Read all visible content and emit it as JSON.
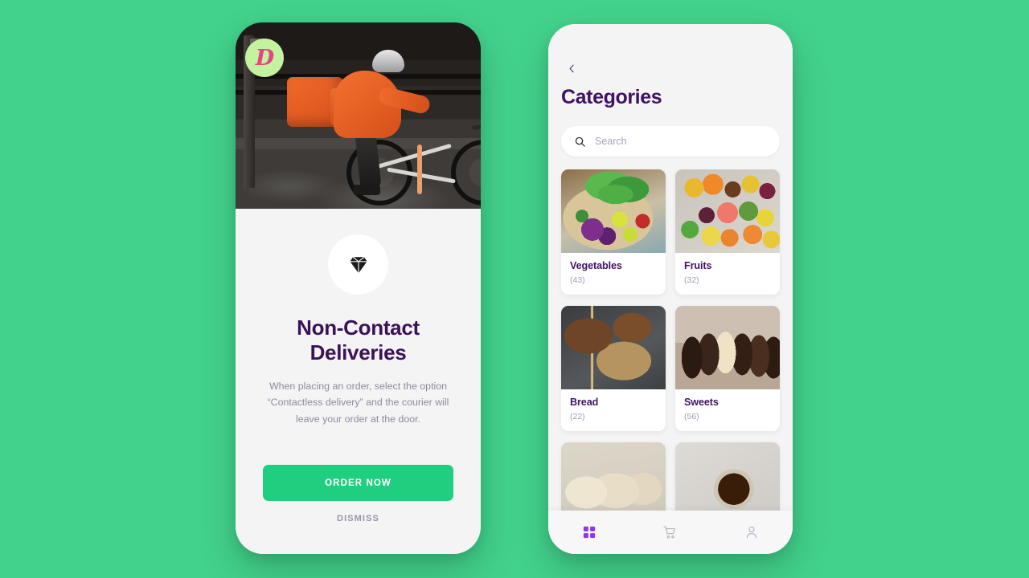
{
  "theme": {
    "background": "#42d28b",
    "accent_green": "#1fce7f",
    "accent_purple": "#3f1265",
    "nav_active_purple": "#9333ea",
    "logo_circle": "#c5f2a0",
    "logo_letter_color": "#e0487f"
  },
  "promo_screen": {
    "logo_letter": "D",
    "logo_icon": "brand-logo-icon",
    "hero_image_alt": "courier-on-bicycle-photo",
    "badge_icon": "diamond-gem-icon",
    "title": "Non-Contact Deliveries",
    "body": "When placing an order, select the option “Contactless delivery” and the courier will leave your order at the door.",
    "primary_button": "ORDER NOW",
    "secondary_button": "DISMISS"
  },
  "categories_screen": {
    "back_icon": "chevron-left-icon",
    "title": "Categories",
    "search": {
      "icon": "search-icon",
      "placeholder": "Search",
      "value": ""
    },
    "cards": [
      {
        "name": "Vegetables",
        "count": "(43)",
        "image": "img-vegetables"
      },
      {
        "name": "Fruits",
        "count": "(32)",
        "image": "img-fruits"
      },
      {
        "name": "Bread",
        "count": "(22)",
        "image": "img-bread"
      },
      {
        "name": "Sweets",
        "count": "(56)",
        "image": "img-sweets"
      },
      {
        "name": "",
        "count": "",
        "image": "img-pasta"
      },
      {
        "name": "",
        "count": "",
        "image": "img-tea"
      }
    ],
    "bottom_nav": [
      {
        "icon": "grid-icon",
        "active": true
      },
      {
        "icon": "cart-icon",
        "active": false
      },
      {
        "icon": "person-icon",
        "active": false
      }
    ]
  }
}
